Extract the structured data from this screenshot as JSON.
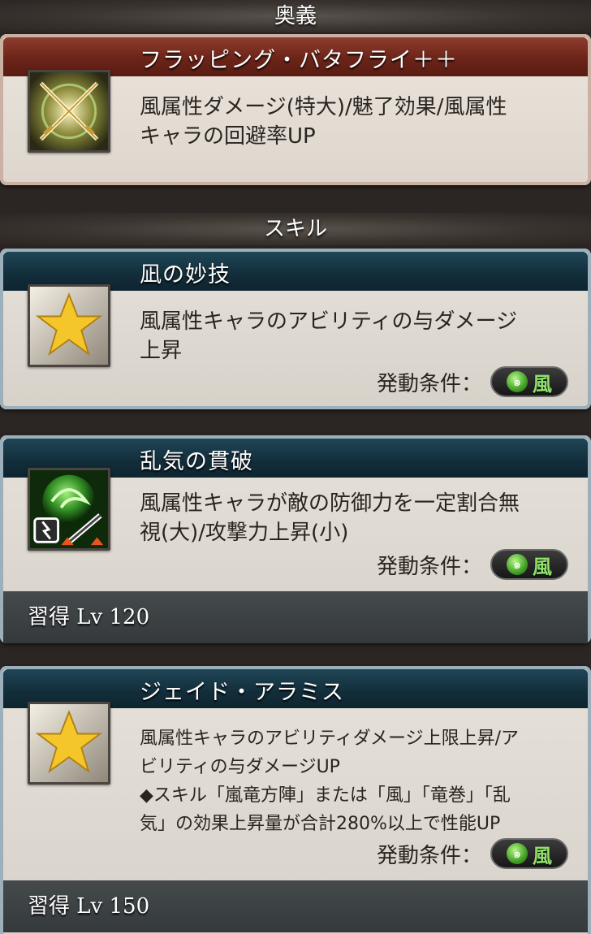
{
  "ougi_section": {
    "label": "奥義"
  },
  "ougi": {
    "name": "フラッピング・バタフライ＋＋",
    "description_line1": "風属性ダメージ(特大)/魅了効果/風属性",
    "description_line2": "キャラの回避率UP",
    "icon": "crossed-swords-icon"
  },
  "skill_section": {
    "label": "スキル"
  },
  "skills": [
    {
      "name": "凪の妙技",
      "desc": [
        "風属性キャラのアビリティの与ダメージ",
        "上昇"
      ],
      "condition_label": "発動条件：",
      "element": "風",
      "icon": "star-icon"
    },
    {
      "name": "乱気の貫破",
      "desc": [
        "風属性キャラが敵の防御力を一定割合無",
        "視(大)/攻撃力上昇(小)"
      ],
      "condition_label": "発動条件：",
      "element": "風",
      "icon": "wind-break-icon",
      "learn_label": "習得",
      "learn_lv": "Lv 120"
    },
    {
      "name": "ジェイド・アラミス",
      "desc": [
        "風属性キャラのアビリティダメージ上限上昇/ア",
        "ビリティの与ダメージUP",
        "◆スキル「嵐竜方陣」または「風」「竜巻」「乱",
        "気」の効果上昇量が合計280%以上で性能UP"
      ],
      "condition_label": "発動条件：",
      "element": "風",
      "icon": "star-icon",
      "learn_label": "習得",
      "learn_lv": "Lv 150"
    }
  ],
  "colors": {
    "ougi_title_bar": "#6b2418",
    "skill_title_bar": "#122d3a",
    "wind_green": "#8fe26a"
  }
}
